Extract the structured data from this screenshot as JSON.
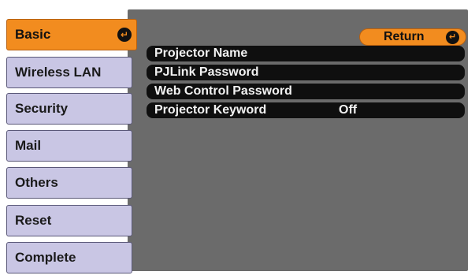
{
  "sidebar": {
    "items": [
      {
        "label": "Basic"
      },
      {
        "label": "Wireless LAN"
      },
      {
        "label": "Security"
      },
      {
        "label": "Mail"
      },
      {
        "label": "Others"
      },
      {
        "label": "Reset"
      },
      {
        "label": "Complete"
      }
    ],
    "active_icon": "enter-icon"
  },
  "header": {
    "return_label": "Return",
    "return_icon": "enter-icon"
  },
  "settings": {
    "rows": [
      {
        "label": "Projector Name",
        "value": ""
      },
      {
        "label": "PJLink Password",
        "value": ""
      },
      {
        "label": "Web Control Password",
        "value": ""
      },
      {
        "label": "Projector Keyword",
        "value": "Off"
      }
    ]
  },
  "colors": {
    "accent": "#f28c1f",
    "nav_bg": "#c9c6e4",
    "panel_bg": "#6b6b6b",
    "row_bg": "#0f0f0f"
  }
}
